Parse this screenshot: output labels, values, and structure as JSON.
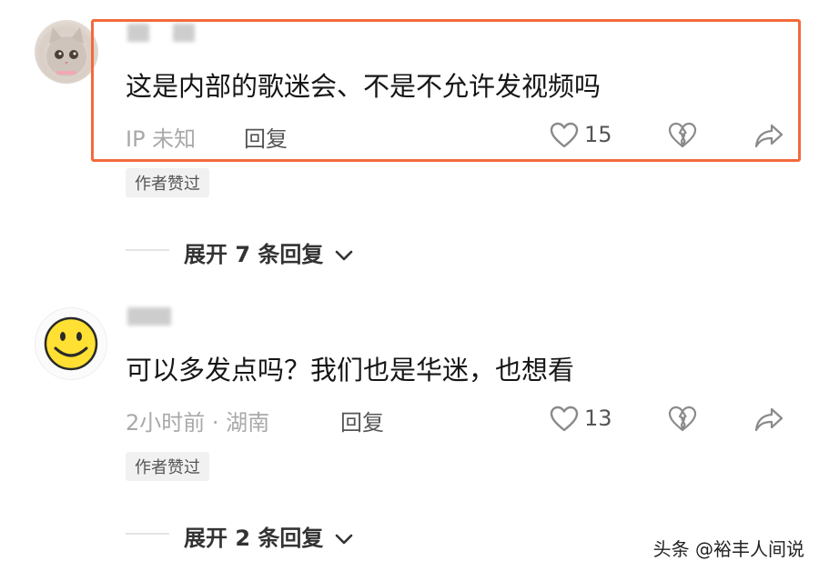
{
  "comments": [
    {
      "text": "这是内部的歌迷会、不是不允许发视频吗",
      "meta": "IP 未知",
      "reply_label": "回复",
      "likes": "15",
      "badge": "作者赞过",
      "expand_label": "展开 7 条回复",
      "avatar_icon": "cat-avatar",
      "highlight_color": "#f26a3b"
    },
    {
      "text": "可以多发点吗？我们也是华迷，也想看",
      "meta": "2小时前 · 湖南",
      "reply_label": "回复",
      "likes": "13",
      "badge": "作者赞过",
      "expand_label": "展开 2 条回复",
      "avatar_icon": "smiley-avatar"
    }
  ],
  "watermark": "头条 @裕丰人间说",
  "icons": {
    "like": "heart-icon",
    "dislike": "broken-heart-icon",
    "share": "share-icon",
    "expand": "chevron-down-icon"
  }
}
